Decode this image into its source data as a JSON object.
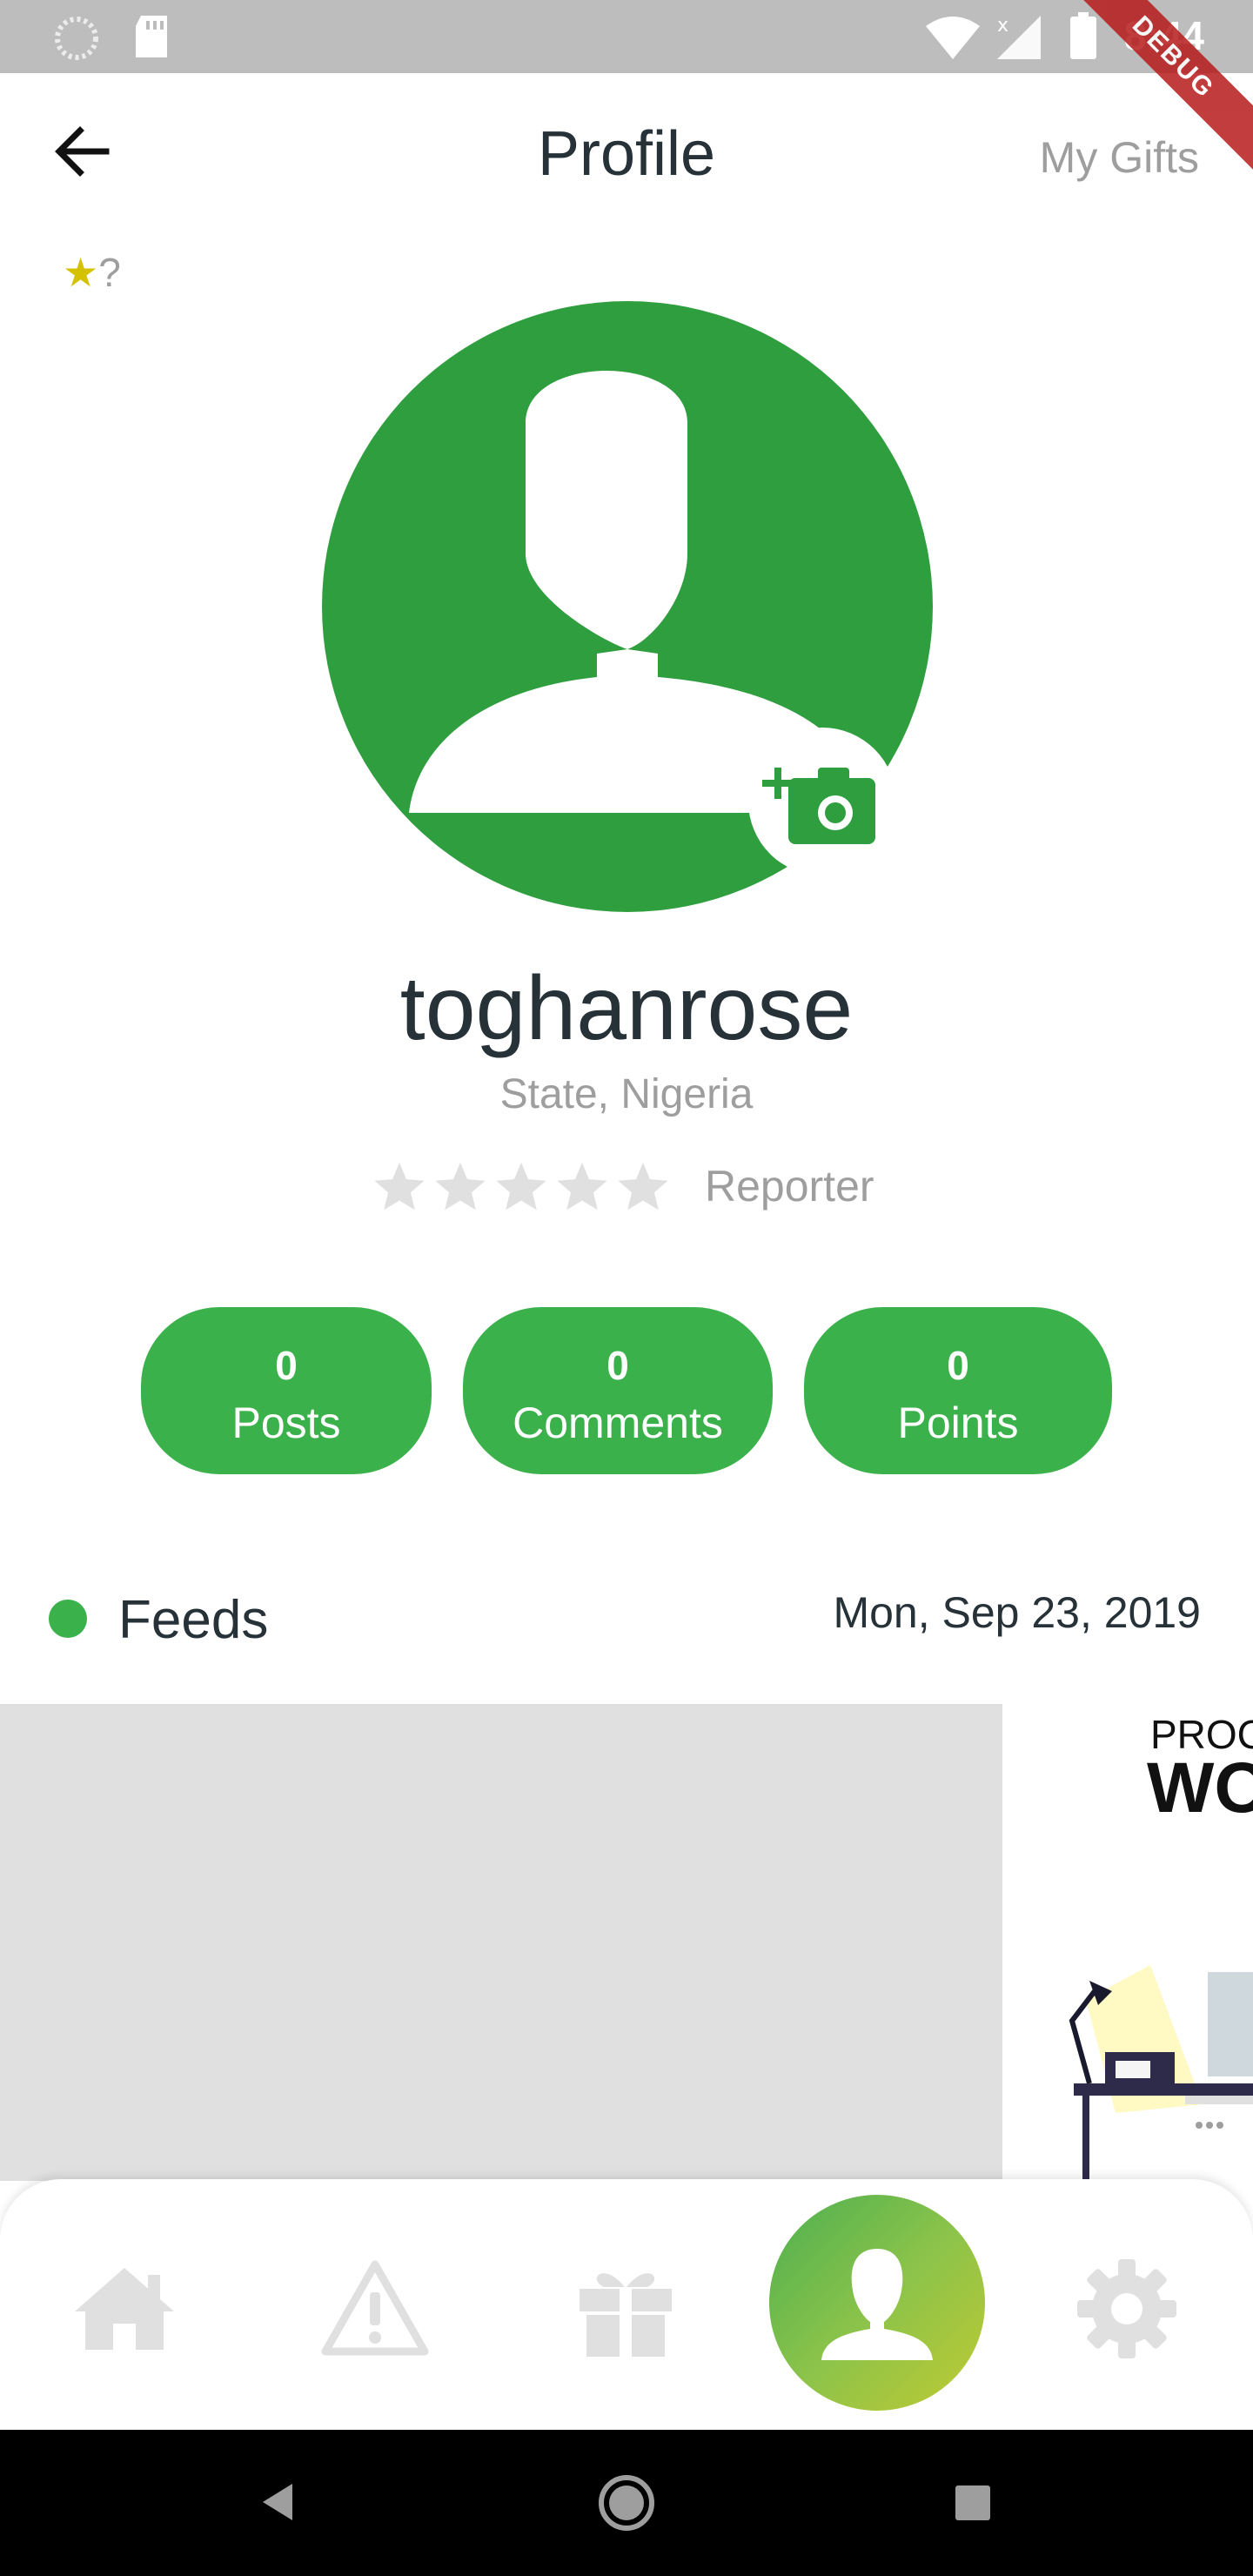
{
  "status_bar": {
    "time": "8:44",
    "debug_label": "DEBUG",
    "icons": [
      "loading-icon",
      "sd-card-icon",
      "wifi-icon",
      "signal-icon",
      "battery-icon"
    ]
  },
  "app_bar": {
    "title": "Profile",
    "right_link": "My Gifts",
    "back_icon": "arrow-left-icon"
  },
  "badge": {
    "star": "★",
    "text": "?"
  },
  "profile": {
    "username": "toghanrose",
    "location": "State, Nigeria",
    "rating": 0,
    "rating_max": 5,
    "rank": "Reporter"
  },
  "stats": [
    {
      "value": "0",
      "label": "Posts"
    },
    {
      "value": "0",
      "label": "Comments"
    },
    {
      "value": "0",
      "label": "Points"
    }
  ],
  "feeds": {
    "title": "Feeds",
    "date": "Mon, Sep 23, 2019",
    "card_text_1": "PROC",
    "card_text_2": "WO"
  },
  "bottom_nav": {
    "items": [
      "home-icon",
      "warning-icon",
      "gift-icon",
      "profile-icon",
      "settings-icon"
    ],
    "active": "profile-icon"
  },
  "colors": {
    "green": "#3bb14b",
    "avatar_green": "#2f9e3f",
    "star_yellow": "#d4c200",
    "inactive_gray": "#e0e0e0"
  }
}
